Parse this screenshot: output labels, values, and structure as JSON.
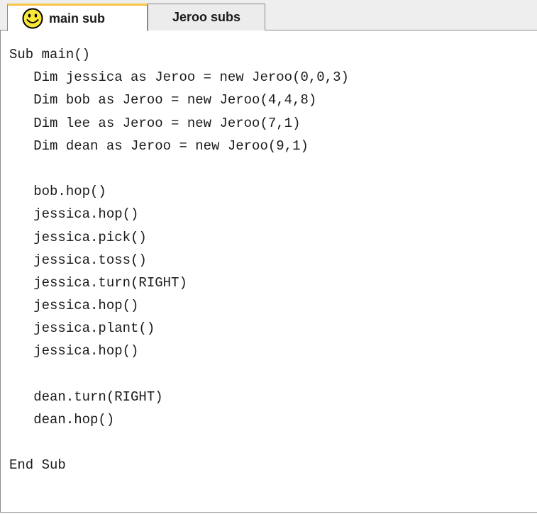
{
  "tabs": [
    {
      "label": "main sub",
      "icon": "smiley-icon",
      "active": true
    },
    {
      "label": "Jeroo subs",
      "active": false
    }
  ],
  "editor": {
    "lines": [
      "Sub main()",
      "   Dim jessica as Jeroo = new Jeroo(0,0,3)",
      "   Dim bob as Jeroo = new Jeroo(4,4,8)",
      "   Dim lee as Jeroo = new Jeroo(7,1)",
      "   Dim dean as Jeroo = new Jeroo(9,1)",
      "",
      "   bob.hop()",
      "   jessica.hop()",
      "   jessica.pick()",
      "   jessica.toss()",
      "   jessica.turn(RIGHT)",
      "   jessica.hop()",
      "   jessica.plant()",
      "   jessica.hop()",
      "",
      "   dean.turn(RIGHT)",
      "   dean.hop()",
      "",
      "End Sub"
    ]
  },
  "colors": {
    "smiley_fill": "#fbe73a",
    "smiley_stroke": "#000000",
    "active_tab_highlight": "#f5c543"
  }
}
